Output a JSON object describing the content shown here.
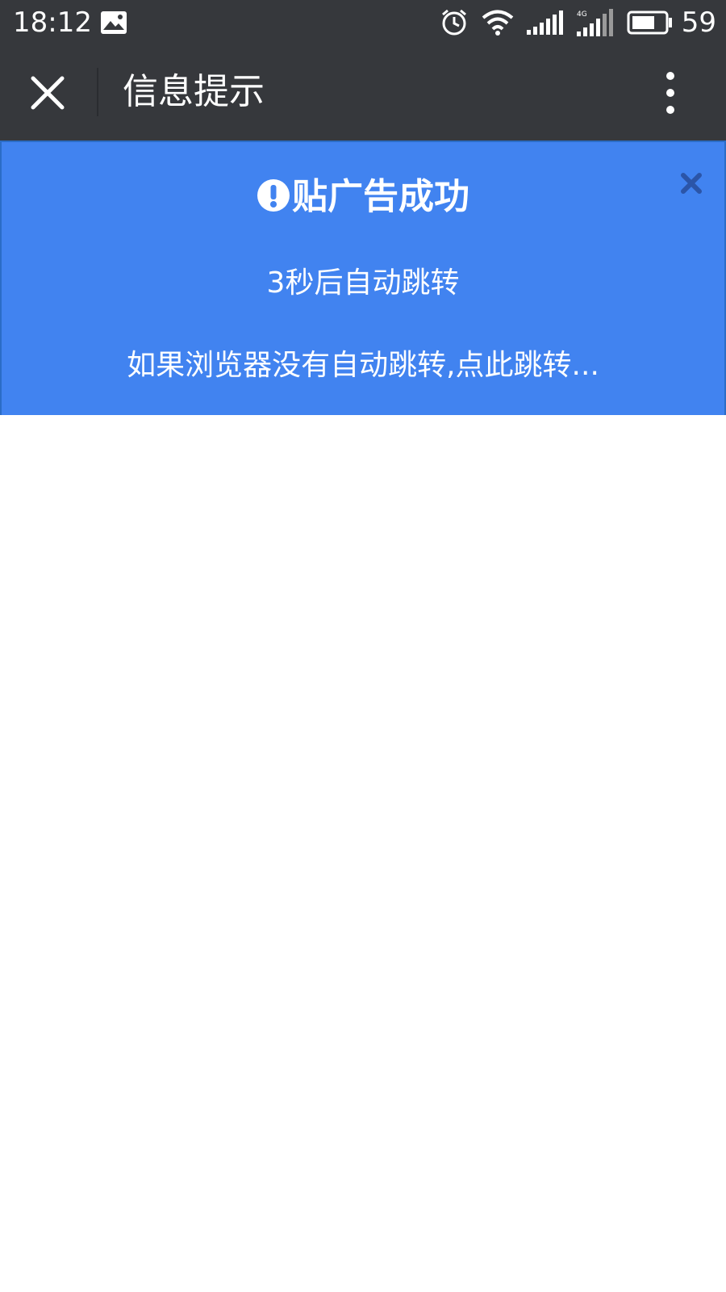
{
  "status_bar": {
    "time": "18:12",
    "battery_level": "59",
    "icons": [
      "gallery-icon",
      "alarm-icon",
      "wifi-icon",
      "signal-icon",
      "signal-4g-icon",
      "battery-icon"
    ]
  },
  "toolbar": {
    "title": "信息提示",
    "close_icon": "close-icon",
    "more_icon": "more-vertical-icon"
  },
  "notice": {
    "title": "贴广告成功",
    "countdown": "3秒后自动跳转",
    "redirect_link": "如果浏览器没有自动跳转,点此跳转...",
    "background_color": "#4183f0",
    "close_icon": "close-icon"
  },
  "colors": {
    "bar_background": "#36383c",
    "notice_background": "#4183f0",
    "notice_close": "#2b55a8"
  }
}
